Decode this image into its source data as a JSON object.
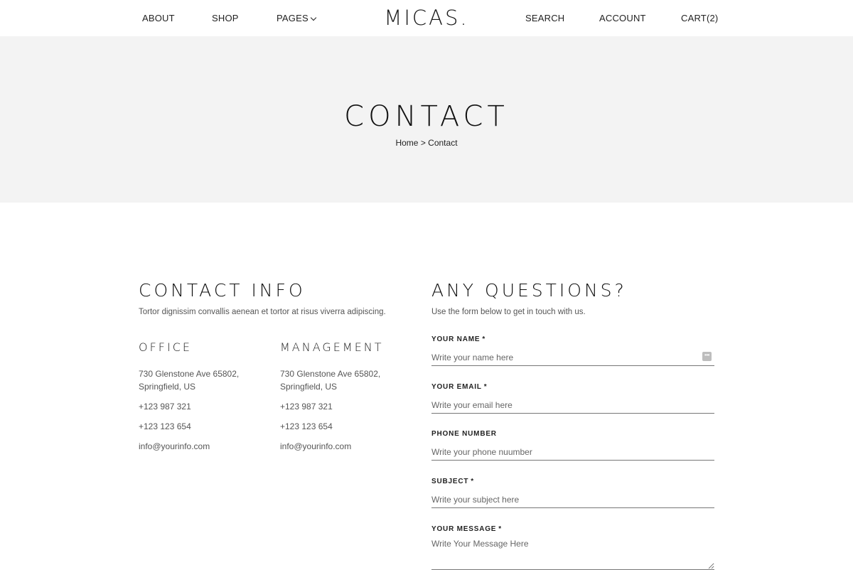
{
  "header": {
    "nav_left": [
      "ABOUT",
      "SHOP",
      "PAGES"
    ],
    "logo": "MICAS.",
    "nav_right": [
      "SEARCH",
      "ACCOUNT",
      "CART(2)"
    ]
  },
  "hero": {
    "title": "CONTACT",
    "breadcrumb": {
      "home": "Home",
      "separator": ">",
      "current": "Contact"
    }
  },
  "contact_info": {
    "title": "CONTACT INFO",
    "intro": "Tortor dignissim convallis aenean et tortor at risus viverra adipiscing.",
    "office": {
      "title": "OFFICE",
      "address": "730 Glenstone Ave 65802, Springfield, US",
      "phone1": "+123 987 321",
      "phone2": "+123 123 654",
      "email": "info@yourinfo.com"
    },
    "management": {
      "title": "MANAGEMENT",
      "address": "730 Glenstone Ave 65802, Springfield, US",
      "phone1": "+123 987 321",
      "phone2": "+123 123 654",
      "email": "info@yourinfo.com"
    }
  },
  "form": {
    "title": "ANY QUESTIONS?",
    "intro": "Use the form below to get in touch with us.",
    "fields": [
      {
        "label": "YOUR NAME",
        "required": "*",
        "placeholder": "Write your name here"
      },
      {
        "label": "YOUR EMAIL",
        "required": "*",
        "placeholder": "Write your email here"
      },
      {
        "label": "PHONE NUMBER",
        "required": "",
        "placeholder": "Write your phone nuumber"
      },
      {
        "label": "SUBJECT",
        "required": "*",
        "placeholder": "Write your subject here"
      },
      {
        "label": "YOUR MESSAGE",
        "required": "*",
        "placeholder": "Write Your Message Here"
      }
    ]
  },
  "icons": {
    "pages_dropdown": "chevron-down-icon",
    "name_field": "autofill-key-icon"
  }
}
